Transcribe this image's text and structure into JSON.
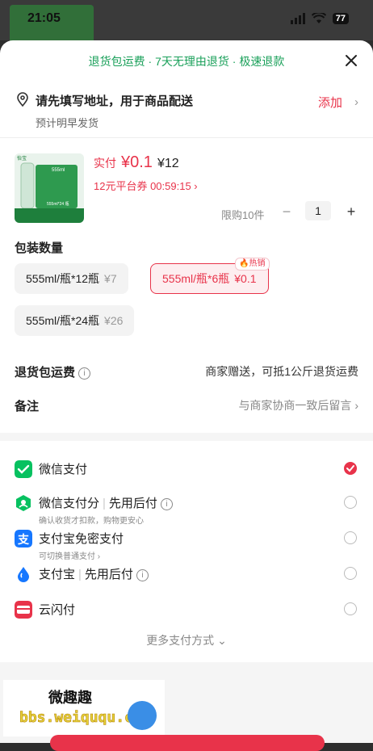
{
  "status_bar": {
    "time": "21:05",
    "battery": "77"
  },
  "banner": {
    "text": "退货包运费 · 7天无理由退货 · 极速退款"
  },
  "address": {
    "placeholder": "请先填写地址，用于商品配送",
    "delivery_note": "预计明早发货",
    "add_label": "添加",
    "chevron": "›"
  },
  "product": {
    "thumb_lines": [
      "怡宝",
      "555ml",
      "555ml*24 瓶"
    ],
    "pay_label": "实付",
    "pay_price": "¥0.1",
    "original_price": "¥12",
    "coupon": "12元平台券 00:59:15 ›",
    "limit": "限购10件",
    "minus": "−",
    "quantity": "1",
    "plus": "+"
  },
  "packaging": {
    "title": "包装数量",
    "options": [
      {
        "label": "555ml/瓶*12瓶",
        "price": "¥7",
        "selected": false
      },
      {
        "label": "555ml/瓶*6瓶",
        "price": "¥0.1",
        "selected": true,
        "badge": "热销"
      },
      {
        "label": "555ml/瓶*24瓶",
        "price": "¥26",
        "selected": false
      }
    ]
  },
  "return_fee": {
    "label": "退货包运费",
    "value": "商家赠送，可抵1公斤退货运费",
    "info": "i"
  },
  "remark": {
    "label": "备注",
    "value": "与商家协商一致后留言 ›"
  },
  "payment": {
    "methods": [
      {
        "name": "微信支付",
        "selected": true,
        "icon": "wechat-pay-icon",
        "color": "#07c160"
      },
      {
        "name": "微信支付分",
        "tag": "先用后付",
        "sub": "确认收货才扣款，购物更安心",
        "info": "i",
        "selected": false,
        "icon": "wechat-score-icon",
        "color": "#07c160"
      },
      {
        "name": "支付宝免密支付",
        "sub": "可切换普通支付 ›",
        "selected": false,
        "icon": "alipay-icon",
        "color": "#1677ff"
      },
      {
        "name": "支付宝",
        "tag": "先用后付",
        "info": "i",
        "selected": false,
        "icon": "alipay-drop-icon",
        "color": "#1677ff"
      },
      {
        "name": "云闪付",
        "selected": false,
        "icon": "unionpay-quickpass-icon",
        "color": "#e8334a"
      }
    ],
    "more_label": "更多支付方式 ⌄"
  },
  "watermark": {
    "title": "微趣趣",
    "url": "bbs.weiququ.cn"
  }
}
